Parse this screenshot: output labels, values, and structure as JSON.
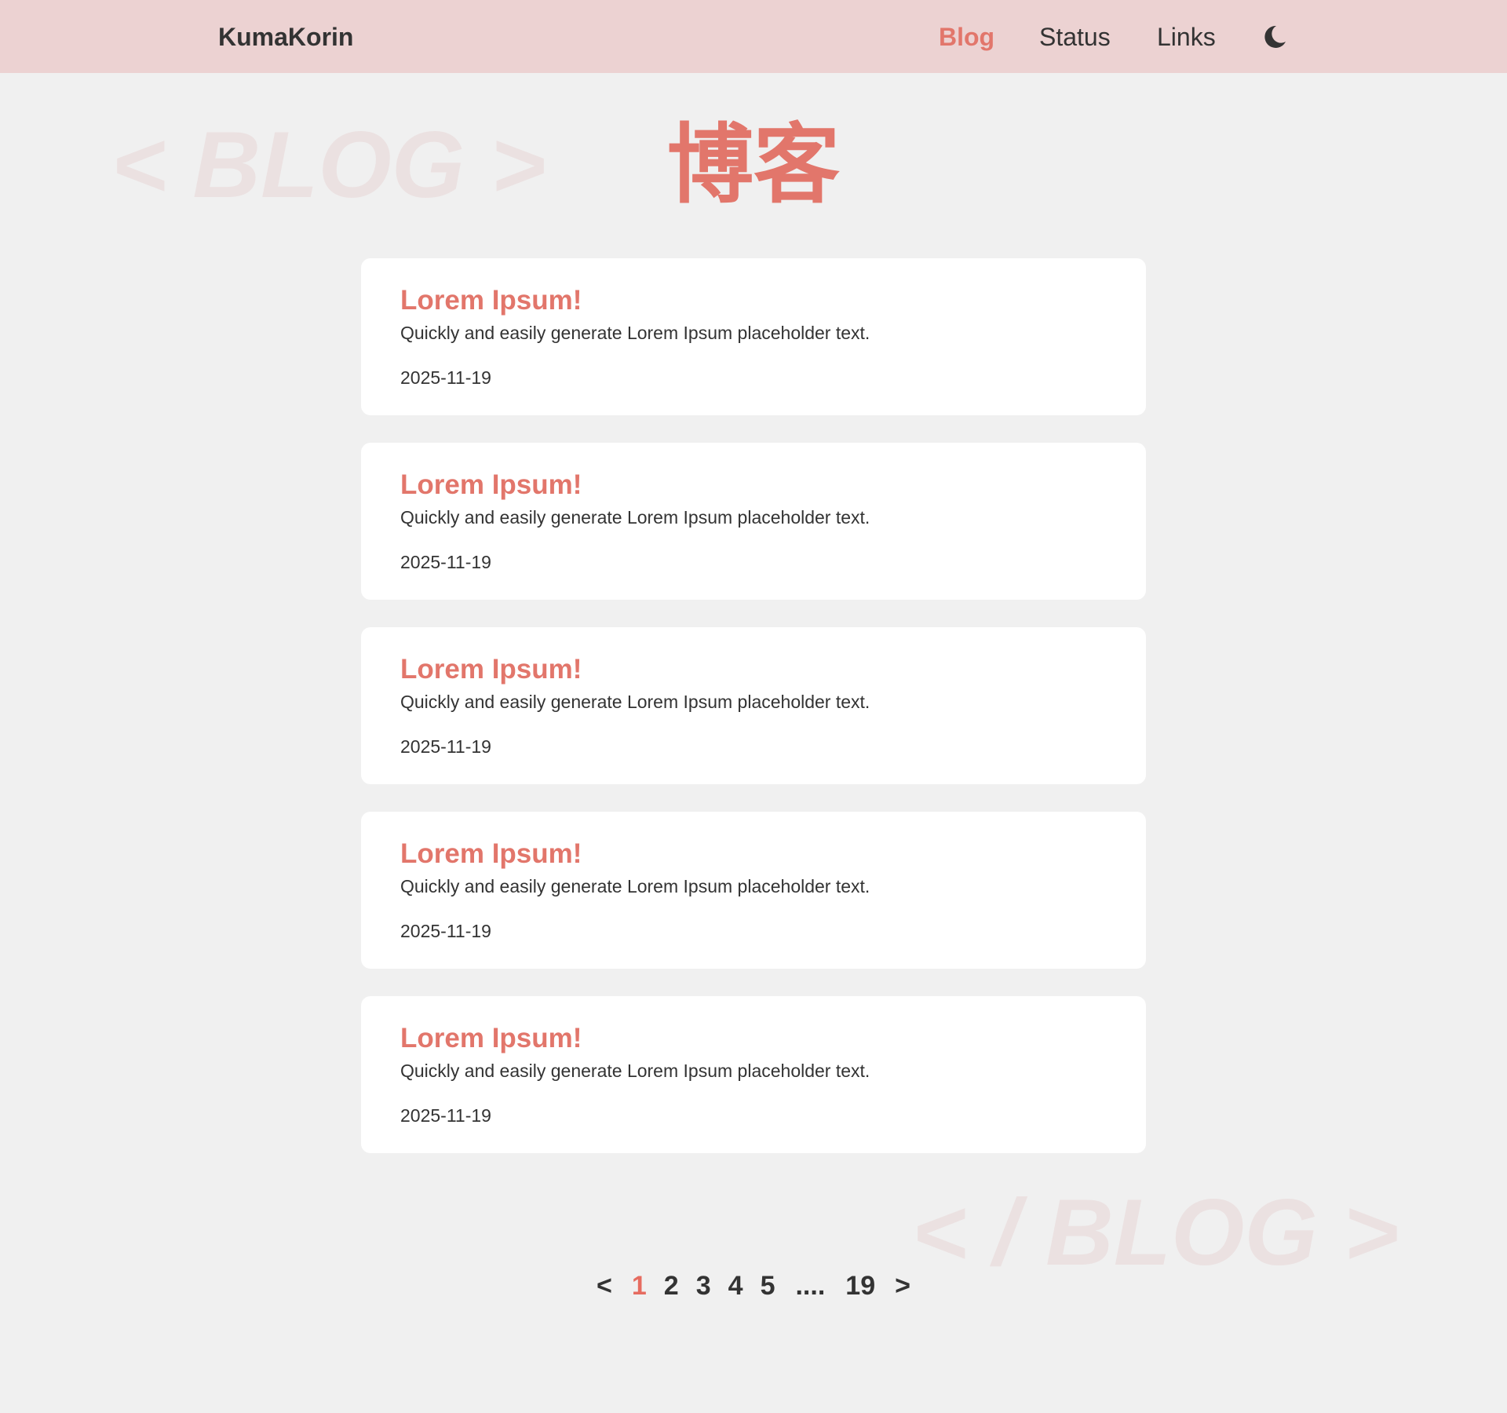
{
  "nav": {
    "brand": "KumaKorin",
    "links": [
      "Blog",
      "Status",
      "Links"
    ],
    "active": "Blog",
    "theme_icon": "moon-icon"
  },
  "watermark": {
    "open": "< BLOG >",
    "close": "< / BLOG >"
  },
  "page": {
    "title": "博客"
  },
  "posts": [
    {
      "title": "Lorem Ipsum!",
      "excerpt": "Quickly and easily generate Lorem Ipsum placeholder text.",
      "date": "2025-11-19"
    },
    {
      "title": "Lorem Ipsum!",
      "excerpt": "Quickly and easily generate Lorem Ipsum placeholder text.",
      "date": "2025-11-19"
    },
    {
      "title": "Lorem Ipsum!",
      "excerpt": "Quickly and easily generate Lorem Ipsum placeholder text.",
      "date": "2025-11-19"
    },
    {
      "title": "Lorem Ipsum!",
      "excerpt": "Quickly and easily generate Lorem Ipsum placeholder text.",
      "date": "2025-11-19"
    },
    {
      "title": "Lorem Ipsum!",
      "excerpt": "Quickly and easily generate Lorem Ipsum placeholder text.",
      "date": "2025-11-19"
    }
  ],
  "pagination": {
    "prev": "<",
    "next": ">",
    "pages": [
      "1",
      "2",
      "3",
      "4",
      "5"
    ],
    "ellipsis": "....",
    "last": "19",
    "current": "1"
  },
  "colors": {
    "accent": "#e2766b",
    "navbar_bg": "#ecd2d2",
    "page_bg": "#f0f0f0",
    "card_bg": "#ffffff",
    "text": "#333333"
  }
}
